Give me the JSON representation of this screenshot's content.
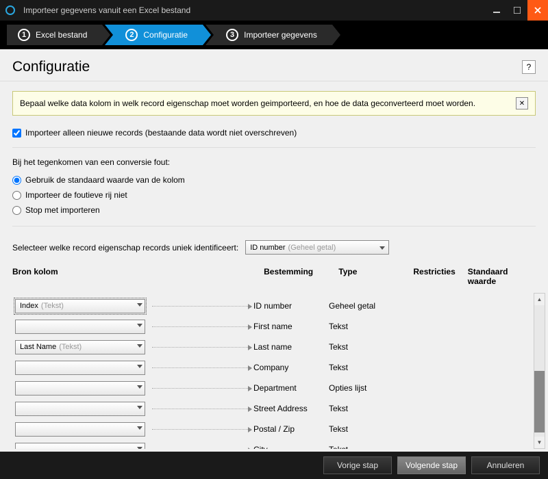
{
  "window": {
    "title": "Importeer gegevens vanuit een Excel bestand"
  },
  "steps": [
    {
      "num": "1",
      "label": "Excel bestand"
    },
    {
      "num": "2",
      "label": "Configuratie"
    },
    {
      "num": "3",
      "label": "Importeer gegevens"
    }
  ],
  "page": {
    "heading": "Configuratie",
    "help": "?"
  },
  "info": {
    "message": "Bepaal welke data kolom in welk record eigenschap moet worden geimporteerd, en hoe de data geconverteerd moet worden.",
    "close": "✕"
  },
  "onlyNew": {
    "label": "Importeer alleen nieuwe records (bestaande data wordt niet overschreven)"
  },
  "conversion": {
    "title": "Bij het tegenkomen van een conversie fout:",
    "options": [
      "Gebruik de standaard waarde van de kolom",
      "Importeer de foutieve rij niet",
      "Stop met importeren"
    ]
  },
  "unique": {
    "label": "Selecteer welke record eigenschap records uniek identificeert:",
    "value": "ID number",
    "hint": "(Geheel getal)"
  },
  "columns": {
    "src": "Bron kolom",
    "dest": "Bestemming",
    "type": "Type",
    "restr": "Restricties",
    "def": "Standaard waarde"
  },
  "rows": [
    {
      "src": "Index",
      "srcHint": "(Tekst)",
      "dest": "ID number",
      "type": "Geheel getal"
    },
    {
      "src": "",
      "srcHint": "",
      "dest": "First name",
      "type": "Tekst"
    },
    {
      "src": "Last Name",
      "srcHint": "(Tekst)",
      "dest": "Last name",
      "type": "Tekst"
    },
    {
      "src": "",
      "srcHint": "",
      "dest": "Company",
      "type": "Tekst"
    },
    {
      "src": "",
      "srcHint": "",
      "dest": "Department",
      "type": "Opties lijst"
    },
    {
      "src": "",
      "srcHint": "",
      "dest": "Street Address",
      "type": "Tekst"
    },
    {
      "src": "",
      "srcHint": "",
      "dest": "Postal / Zip",
      "type": "Tekst"
    },
    {
      "src": "",
      "srcHint": "",
      "dest": "City",
      "type": "Tekst"
    }
  ],
  "footer": {
    "prev": "Vorige stap",
    "next": "Volgende stap",
    "cancel": "Annuleren"
  }
}
